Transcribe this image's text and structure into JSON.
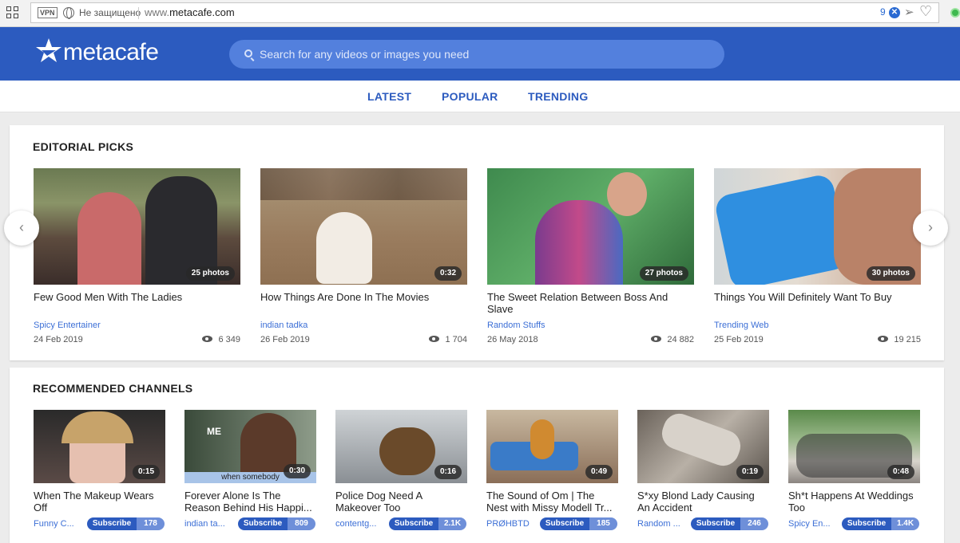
{
  "browser": {
    "vpn": "VPN",
    "security": "Не защищено",
    "url_prefix": "www.",
    "url_domain": "metacafe.com",
    "ext_count": "9"
  },
  "header": {
    "logo": "metacafe",
    "search_placeholder": "Search for any videos or images you need"
  },
  "nav": [
    "LATEST",
    "POPULAR",
    "TRENDING"
  ],
  "editorial": {
    "title": "EDITORIAL PICKS",
    "items": [
      {
        "title": "Few Good Men With The Ladies",
        "badge": "25 photos",
        "channel": "Spicy Entertainer",
        "date": "24 Feb 2019",
        "views": "6 349"
      },
      {
        "title": "How Things Are Done In The Movies",
        "badge": "0:32",
        "channel": "indian tadka",
        "date": "26 Feb 2019",
        "views": "1 704"
      },
      {
        "title": "The Sweet Relation Between Boss And Slave",
        "badge": "27 photos",
        "channel": "Random Stuffs",
        "date": "26 May 2018",
        "views": "24 882"
      },
      {
        "title": "Things You Will Definitely Want To Buy",
        "badge": "30 photos",
        "channel": "Trending Web",
        "date": "25 Feb 2019",
        "views": "19 215"
      }
    ]
  },
  "channels": {
    "title": "RECOMMENDED CHANNELS",
    "subscribe_label": "Subscribe",
    "items": [
      {
        "title": "When The Makeup Wears Off",
        "badge": "0:15",
        "channel": "Funny C...",
        "subs": "178"
      },
      {
        "title": "Forever Alone Is The Reason Behind His Happi...",
        "badge": "0:30",
        "channel": "indian ta...",
        "subs": "809",
        "caption": "when somebody",
        "overlay": "ME"
      },
      {
        "title": "Police Dog Need A Makeover Too",
        "badge": "0:16",
        "channel": "contentg...",
        "subs": "2.1K"
      },
      {
        "title": "The Sound of Om | The Nest with Missy Modell Tr...",
        "badge": "0:49",
        "channel": "PRØHBTD",
        "subs": "185"
      },
      {
        "title": "S*xy Blond Lady Causing An Accident",
        "badge": "0:19",
        "channel": "Random ...",
        "subs": "246"
      },
      {
        "title": "Sh*t Happens At Weddings Too",
        "badge": "0:48",
        "channel": "Spicy En...",
        "subs": "1.4K"
      }
    ]
  },
  "colors": {
    "brand": "#2c5bbf",
    "link": "#3c6fd6"
  }
}
